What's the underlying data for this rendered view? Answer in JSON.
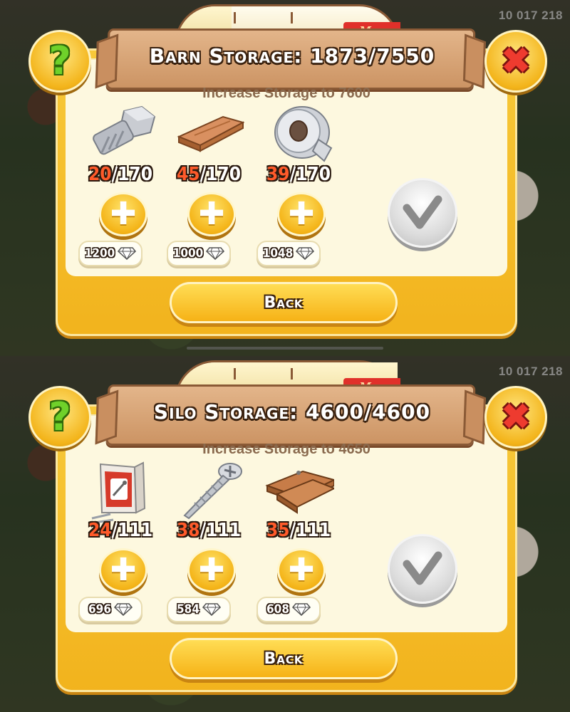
{
  "panels": [
    {
      "hud_coins": "10 017 218",
      "title": "Barn Storage: 1873/7550",
      "max_tag": "Max",
      "capacity_fraction": 0.248,
      "subtitle": "Increase Storage to 7600",
      "items": [
        {
          "icon": "bolt-icon",
          "have": "20",
          "need": "/170",
          "price": "1200"
        },
        {
          "icon": "plank-icon",
          "have": "45",
          "need": "/170",
          "price": "1000"
        },
        {
          "icon": "duct-tape-icon",
          "have": "39",
          "need": "/170",
          "price": "1048"
        }
      ],
      "back_label": "Back"
    },
    {
      "hud_coins": "10 017 218",
      "title": "Silo Storage: 4600/4600",
      "max_tag": "Max",
      "capacity_fraction": 1.0,
      "subtitle": "Increase Storage to 4650",
      "items": [
        {
          "icon": "nails-box-icon",
          "have": "24",
          "need": "/111",
          "price": "696"
        },
        {
          "icon": "screw-icon",
          "have": "38",
          "need": "/111",
          "price": "584"
        },
        {
          "icon": "wood-panel-icon",
          "have": "35",
          "need": "/111",
          "price": "608"
        }
      ],
      "back_label": "Back"
    }
  ],
  "colors": {
    "dialog": "#f2b31d",
    "panel": "#fdf8df",
    "wood": "#cc9464",
    "count_have": "#ff5a2a",
    "help": "#6fd12a",
    "close": "#ee3b2f",
    "max_tag": "#e0302a"
  }
}
